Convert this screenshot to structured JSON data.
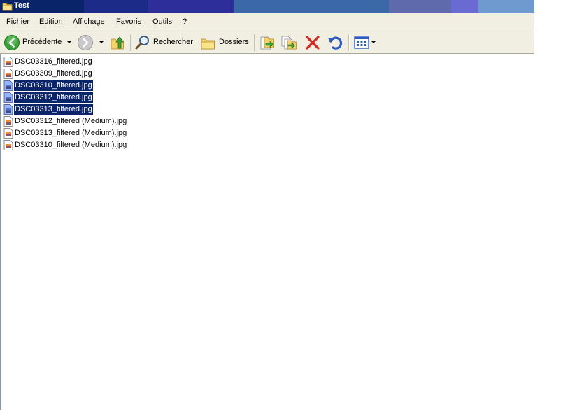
{
  "window": {
    "title": "Test"
  },
  "menu": {
    "items": [
      "Fichier",
      "Edition",
      "Affichage",
      "Favoris",
      "Outils",
      "?"
    ]
  },
  "toolbar": {
    "back_label": "Précédente",
    "search_label": "Rechercher",
    "folders_label": "Dossiers"
  },
  "files": [
    {
      "name": "DSC03316_filtered.jpg",
      "selected": false
    },
    {
      "name": "DSC03309_filtered.jpg",
      "selected": false
    },
    {
      "name": "DSC03310_filtered.jpg",
      "selected": true
    },
    {
      "name": "DSC03312_filtered.jpg",
      "selected": true
    },
    {
      "name": "DSC03313_filtered.jpg",
      "selected": true
    },
    {
      "name": "DSC03312_filtered (Medium).jpg",
      "selected": false
    },
    {
      "name": "DSC03313_filtered (Medium).jpg",
      "selected": false
    },
    {
      "name": "DSC03310_filtered (Medium).jpg",
      "selected": false
    }
  ],
  "colors": {
    "selection": "#0a246a",
    "toolbar_bg": "#f1efe2",
    "delete_red": "#d9261c",
    "back_green": "#3aa43a"
  }
}
